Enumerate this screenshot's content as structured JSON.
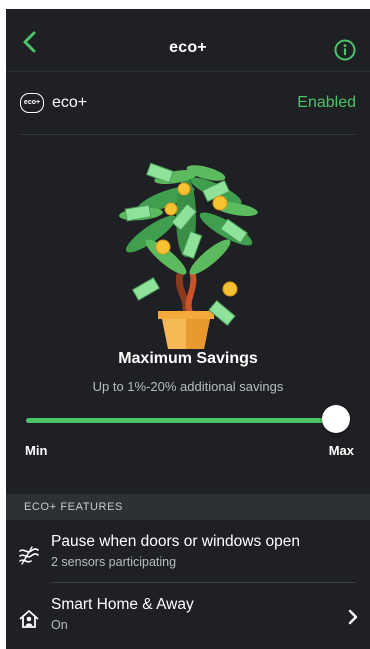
{
  "header": {
    "title": "eco+"
  },
  "eco": {
    "badge": "eco+",
    "label": "eco+",
    "status": "Enabled"
  },
  "mode": {
    "title": "Maximum Savings",
    "subtitle": "Up to 1%-20% additional savings",
    "slider_value": 1.0,
    "min_label": "Min",
    "max_label": "Max"
  },
  "section": {
    "label": "ECO+ FEATURES"
  },
  "features": [
    {
      "title": "Pause when doors or windows open",
      "subtitle": "2 sensors participating",
      "icon": "wind-icon"
    },
    {
      "title": "Smart Home & Away",
      "subtitle": "On",
      "icon": "home-person-icon"
    }
  ],
  "colors": {
    "accent": "#4cc366",
    "background": "#1e2024",
    "section": "#2d3035"
  }
}
